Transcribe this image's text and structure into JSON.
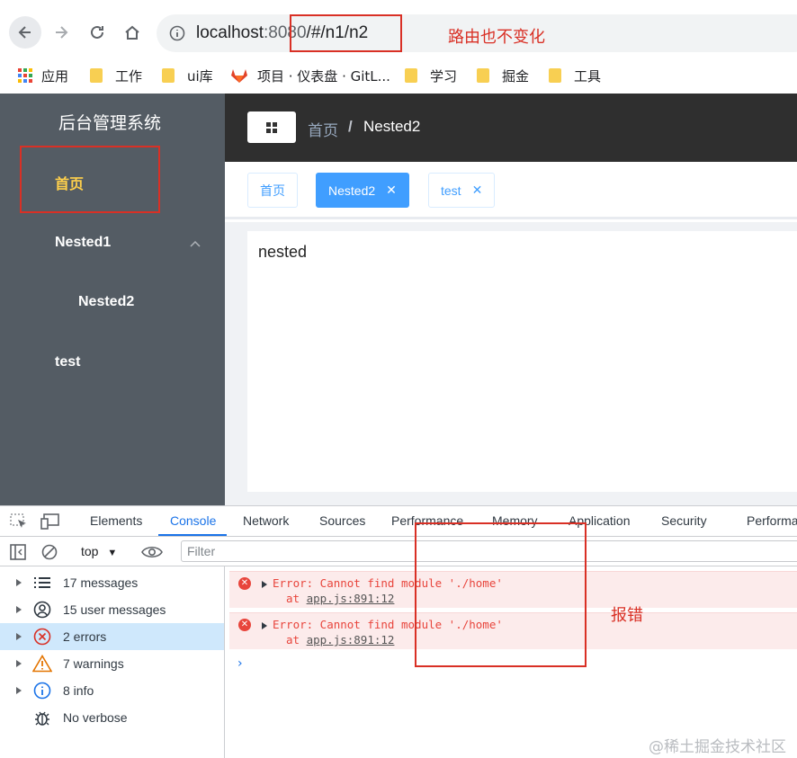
{
  "browser": {
    "url_host": "localhost",
    "url_port": ":8080",
    "url_path": "/#/n1/n2",
    "bookmarks": [
      "应用",
      "工作",
      "ui库",
      "项目 · 仪表盘 · GitL...",
      "学习",
      "掘金",
      "工具"
    ]
  },
  "annotations": {
    "route_note": "路由也不变化",
    "error_note": "报错",
    "color": "#d93025"
  },
  "sidebar": {
    "title": "后台管理系统",
    "items": [
      {
        "label": "首页",
        "active": true
      },
      {
        "label": "Nested1"
      },
      {
        "label": "Nested2"
      },
      {
        "label": "test"
      }
    ],
    "active_color": "#ffd04b"
  },
  "header": {
    "breadcrumb": [
      "首页",
      "/",
      "Nested2"
    ]
  },
  "tags": [
    {
      "label": "首页",
      "closable": false
    },
    {
      "label": "Nested2",
      "closable": true,
      "active": true
    },
    {
      "label": "test",
      "closable": true
    }
  ],
  "content": {
    "text": "nested"
  },
  "devtools": {
    "tabs": [
      "Elements",
      "Console",
      "Network",
      "Sources",
      "Performance",
      "Memory",
      "Application",
      "Security",
      "Performa"
    ],
    "active_tab": "Console",
    "context": "top",
    "filter_placeholder": "Filter",
    "sidebar": [
      {
        "label": "17 messages",
        "icon": "list-icon"
      },
      {
        "label": "15 user messages",
        "icon": "user-icon"
      },
      {
        "label": "2 errors",
        "icon": "error-icon",
        "selected": true
      },
      {
        "label": "7 warnings",
        "icon": "warning-icon"
      },
      {
        "label": "8 info",
        "icon": "info-icon"
      },
      {
        "label": "No verbose",
        "icon": "bug-icon"
      }
    ],
    "errors": [
      {
        "message": "Error: Cannot find module './home'",
        "at": "at",
        "source": "app.js:891:12"
      },
      {
        "message": "Error: Cannot find module './home'",
        "at": "at",
        "source": "app.js:891:12"
      }
    ],
    "prompt": "›"
  },
  "watermark": "@稀土掘金技术社区"
}
